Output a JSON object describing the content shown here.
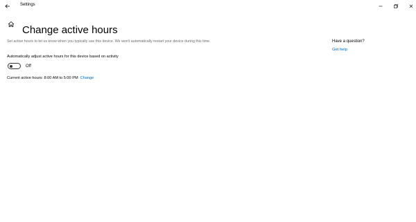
{
  "window": {
    "title": "Settings",
    "back_icon": "back-arrow-icon",
    "controls": [
      "minimize-icon",
      "restore-icon",
      "close-icon"
    ]
  },
  "page": {
    "home_icon": "home-icon",
    "title": "Change active hours",
    "description": "Set active hours to let us know when you typically use this device. We won't automatically restart your device during this time.",
    "toggle": {
      "label": "Automatically adjust active hours for this device based on activity",
      "state_text": "Off",
      "on": false
    },
    "current_hours": {
      "text": "Current active hours: 8:00 AM to 5:00 PM",
      "change_link": "Change"
    }
  },
  "help": {
    "heading": "Have a question?",
    "link": "Get help"
  },
  "colors": {
    "accent": "#0067b8",
    "secondary_text": "#6b6b6b",
    "background": "#ffffff"
  }
}
